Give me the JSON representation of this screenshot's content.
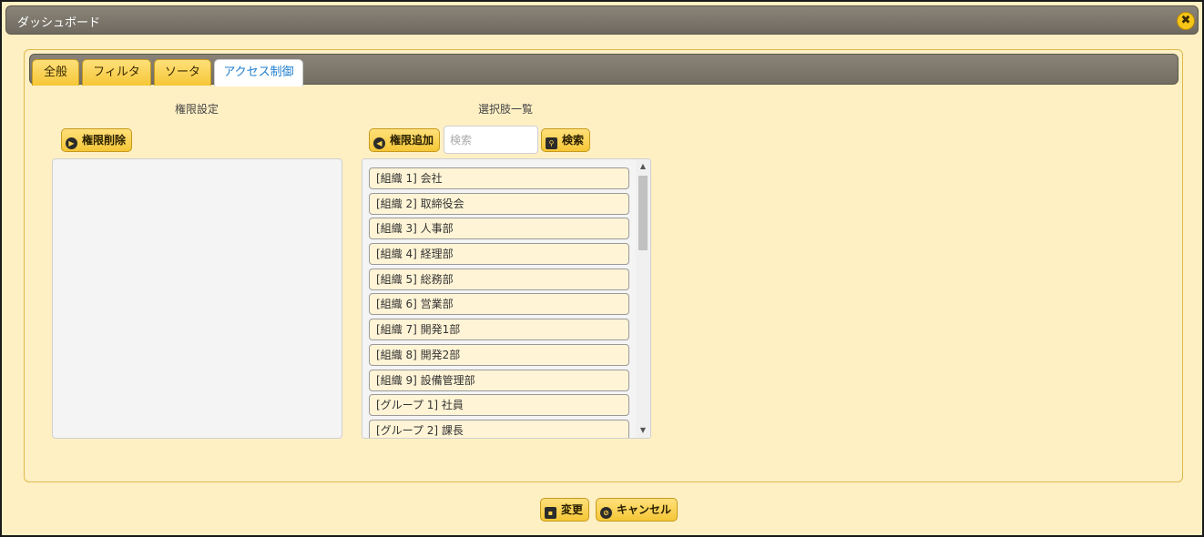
{
  "window": {
    "title": "ダッシュボード",
    "close_glyph": "✖"
  },
  "tabs": [
    {
      "label": "全般"
    },
    {
      "label": "フィルタ"
    },
    {
      "label": "ソータ"
    },
    {
      "label": "アクセス制御",
      "active": true
    }
  ],
  "left": {
    "title": "権限設定",
    "delete_button": {
      "label": "権限削除",
      "icon": "play-circle-icon"
    }
  },
  "right": {
    "title": "選択肢一覧",
    "add_button": {
      "label": "権限追加",
      "icon": "back-circle-icon"
    },
    "search": {
      "placeholder": "検索",
      "value": ""
    },
    "search_button": {
      "label": "検索",
      "icon": "search-icon"
    },
    "items": [
      "[組織 1] 会社",
      "[組織 2] 取締役会",
      "[組織 3] 人事部",
      "[組織 4] 経理部",
      "[組織 5] 総務部",
      "[組織 6] 営業部",
      "[組織 7] 開発1部",
      "[組織 8] 開発2部",
      "[組織 9] 設備管理部",
      "[グループ 1] 社員",
      "[グループ 2] 課長"
    ]
  },
  "footer": {
    "save_button": {
      "label": "変更",
      "icon": "save-icon"
    },
    "cancel_button": {
      "label": "キャンセル",
      "icon": "cancel-icon"
    }
  },
  "colors": {
    "background": "#fff0c4",
    "titlebar": "#7d776c",
    "button": "#f5c636",
    "active_tab_text": "#1e7fcf",
    "list_item": "#fff4d6"
  }
}
